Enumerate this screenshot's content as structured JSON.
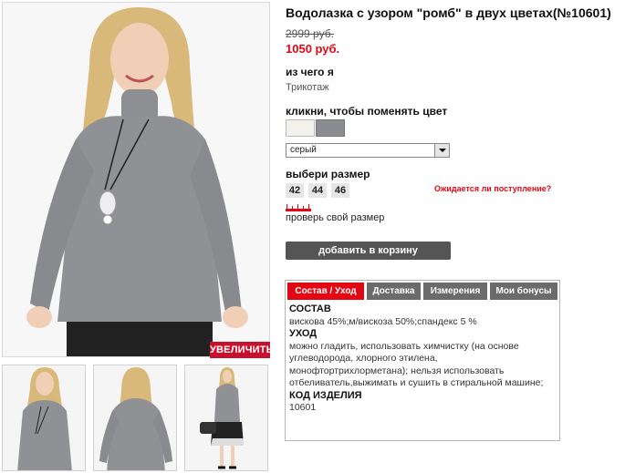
{
  "product": {
    "title": "Водолазка с узором \"ромб\" в двух цветах(№10601)",
    "old_price": "2999 руб.",
    "new_price": "1050 руб."
  },
  "material": {
    "label": "из чего я",
    "value": "Трикотаж"
  },
  "color": {
    "label": "кликни, чтобы поменять цвет",
    "swatches": [
      "#f3f1ec",
      "#8a8c90"
    ],
    "selected": "серый"
  },
  "size": {
    "label": "выбери размер",
    "options": [
      "42",
      "44",
      "46"
    ],
    "awaiting": "Ожидается ли поступление?",
    "check": "проверь свой размер"
  },
  "actions": {
    "add_to_cart": "добавить в корзину",
    "zoom": "УВЕЛИЧИТЬ"
  },
  "tabs": {
    "items": [
      "Состав / Уход",
      "Доставка",
      "Измерения",
      "Мои бонусы"
    ],
    "active": "Состав / Уход"
  },
  "details": {
    "composition_title": "СОСТАВ",
    "composition": "вискова 45%;м/вискоза 50%;спандекс 5 %",
    "care_title": "УХОД",
    "care": "можно гладить, использовать химчистку (на основе углеводорода, хлорного этилена, монофтортрихлорметана); нельзя использовать отбеливатель,выжимать и сушить в стиральной машине;",
    "code_title": "КОД ИЗДЕЛИЯ",
    "code": "10601"
  },
  "colors": {
    "accent_red": "#e30613",
    "tab_grey": "#6b6b6b",
    "cart_button": "#555555"
  }
}
